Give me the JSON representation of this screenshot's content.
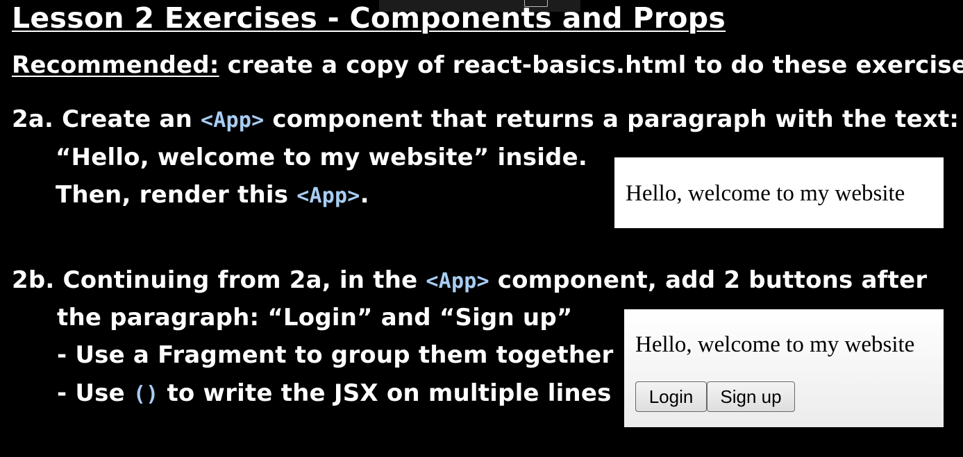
{
  "title": "Lesson 2 Exercises - Components and Props",
  "recommended": {
    "label": "Recommended:",
    "text": " create a copy of react-basics.html to do these exercises."
  },
  "ex2a": {
    "num": "2a.",
    "line1_pre": " Create an ",
    "code_app": "<App>",
    "line1_post": " component that returns a paragraph with the text:",
    "line2": "“Hello, welcome to my website” inside.",
    "line3_pre": "Then, render this ",
    "line3_post": "."
  },
  "demo1": {
    "paragraph": "Hello, welcome to my website"
  },
  "ex2b": {
    "num": "2b.",
    "line1_pre": " Continuing from 2a, in the ",
    "code_app": "<App>",
    "line1_post": " component, add 2 buttons after",
    "line2": "the paragraph: “Login” and “Sign up”",
    "line3": "- Use a Fragment to group them together",
    "line4_pre": "- Use ",
    "code_parens": "()",
    "line4_post": " to write the JSX on multiple lines"
  },
  "demo2": {
    "paragraph": "Hello, welcome to my website",
    "login_label": "Login",
    "signup_label": "Sign up"
  }
}
